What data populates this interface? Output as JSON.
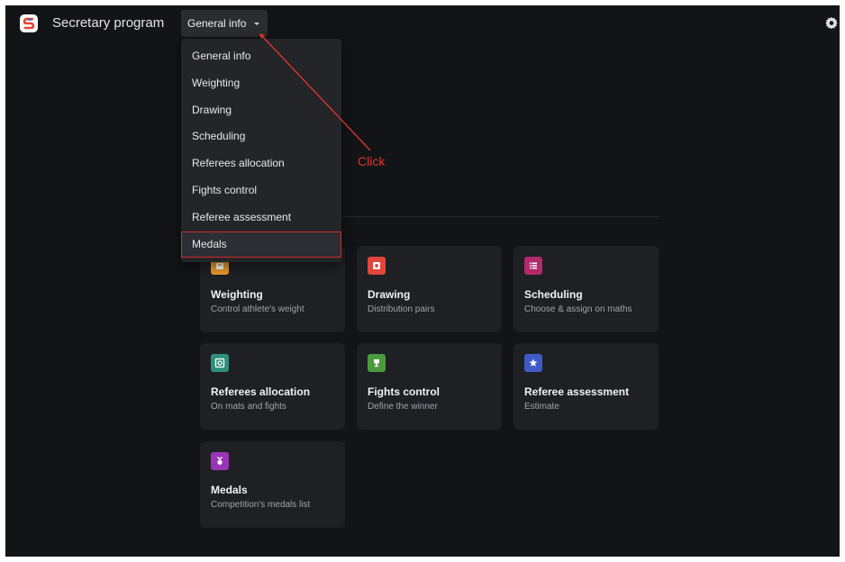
{
  "app": {
    "title": "Secretary program"
  },
  "nav": {
    "current": "General info",
    "menu": [
      "General info",
      "Weighting",
      "Drawing",
      "Scheduling",
      "Referees allocation",
      "Fights control",
      "Referee assessment",
      "Medals"
    ],
    "highlighted": "Medals"
  },
  "annotation": {
    "label": "Click",
    "color": "#e3352b"
  },
  "cards": [
    {
      "title": "Weighting",
      "subtitle": "Control athlete's weight",
      "icon": "scale-icon",
      "color": "#e89a2c"
    },
    {
      "title": "Drawing",
      "subtitle": "Distribution pairs",
      "icon": "drawing-icon",
      "color": "#e0463c"
    },
    {
      "title": "Scheduling",
      "subtitle": "Choose & assign on maths",
      "icon": "schedule-icon",
      "color": "#b3296a"
    },
    {
      "title": "Referees allocation",
      "subtitle": "On mats and fights",
      "icon": "referee-icon",
      "color": "#2f8f7d"
    },
    {
      "title": "Fights control",
      "subtitle": "Define the winner",
      "icon": "trophy-icon",
      "color": "#4c9a3e"
    },
    {
      "title": "Referee assessment",
      "subtitle": "Estimate",
      "icon": "star-icon",
      "color": "#3e5bc7"
    },
    {
      "title": "Medals",
      "subtitle": "Competition's medals list",
      "icon": "medal-icon",
      "color": "#9b35b8"
    }
  ],
  "colors": {
    "background": "#131417",
    "card": "#1e2024",
    "menu": "#232529",
    "highlight_border": "#d62b2b"
  }
}
